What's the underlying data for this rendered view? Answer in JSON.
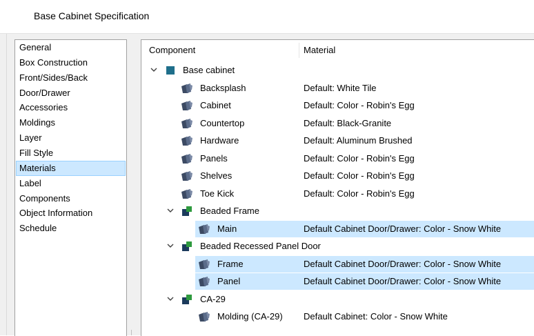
{
  "window": {
    "title": "Base Cabinet Specification"
  },
  "nav": {
    "items": [
      {
        "label": "General"
      },
      {
        "label": "Box Construction"
      },
      {
        "label": "Front/Sides/Back"
      },
      {
        "label": "Door/Drawer"
      },
      {
        "label": "Accessories"
      },
      {
        "label": "Moldings"
      },
      {
        "label": "Layer"
      },
      {
        "label": "Fill Style"
      },
      {
        "label": "Materials",
        "selected": true
      },
      {
        "label": "Label"
      },
      {
        "label": "Components"
      },
      {
        "label": "Object Information"
      },
      {
        "label": "Schedule"
      }
    ]
  },
  "tree": {
    "headers": {
      "component": "Component",
      "material": "Material"
    },
    "rows": [
      {
        "name": "Base cabinet",
        "material": "",
        "icon": "blue-square-icon",
        "level": 0,
        "expander": true
      },
      {
        "name": "Backsplash",
        "material": "Default: White Tile",
        "icon": "material-swatch-icon",
        "level": 1
      },
      {
        "name": "Cabinet",
        "material": "Default: Color - Robin's Egg",
        "icon": "material-swatch-icon",
        "level": 1
      },
      {
        "name": "Countertop",
        "material": "Default: Black-Granite",
        "icon": "material-swatch-icon",
        "level": 1
      },
      {
        "name": "Hardware",
        "material": "Default: Aluminum Brushed",
        "icon": "material-swatch-icon",
        "level": 1
      },
      {
        "name": "Panels",
        "material": "Default: Color - Robin's Egg",
        "icon": "material-swatch-icon",
        "level": 1
      },
      {
        "name": "Shelves",
        "material": "Default: Color - Robin's Egg",
        "icon": "material-swatch-icon",
        "level": 1
      },
      {
        "name": "Toe Kick",
        "material": "Default: Color - Robin's Egg",
        "icon": "material-swatch-icon",
        "level": 1
      },
      {
        "name": "Beaded Frame",
        "material": "",
        "icon": "green-corner-icon",
        "level": 1,
        "expander": true
      },
      {
        "name": "Main",
        "material": "Default Cabinet Door/Drawer: Color - Snow White",
        "icon": "material-swatch-icon",
        "level": 2,
        "selected": true
      },
      {
        "name": "Beaded Recessed Panel Door",
        "material": "",
        "icon": "green-corner-icon",
        "level": 1,
        "expander": true
      },
      {
        "name": "Frame",
        "material": "Default Cabinet Door/Drawer: Color - Snow White",
        "icon": "material-swatch-icon",
        "level": 2,
        "selected": true
      },
      {
        "name": "Panel",
        "material": "Default Cabinet Door/Drawer: Color - Snow White",
        "icon": "material-swatch-icon",
        "level": 2,
        "selected": true
      },
      {
        "name": "CA-29",
        "material": "",
        "icon": "green-corner-icon",
        "level": 1,
        "expander": true
      },
      {
        "name": "Molding (CA-29)",
        "material": "Default Cabinet: Color - Snow White",
        "icon": "material-swatch-icon",
        "level": 2
      }
    ]
  },
  "colors": {
    "selection": "#cce8ff",
    "base_cabinet_icon": "#1f6f8b",
    "component_icon_green": "#2e9a3e",
    "component_icon_navy": "#1b3a5c"
  }
}
